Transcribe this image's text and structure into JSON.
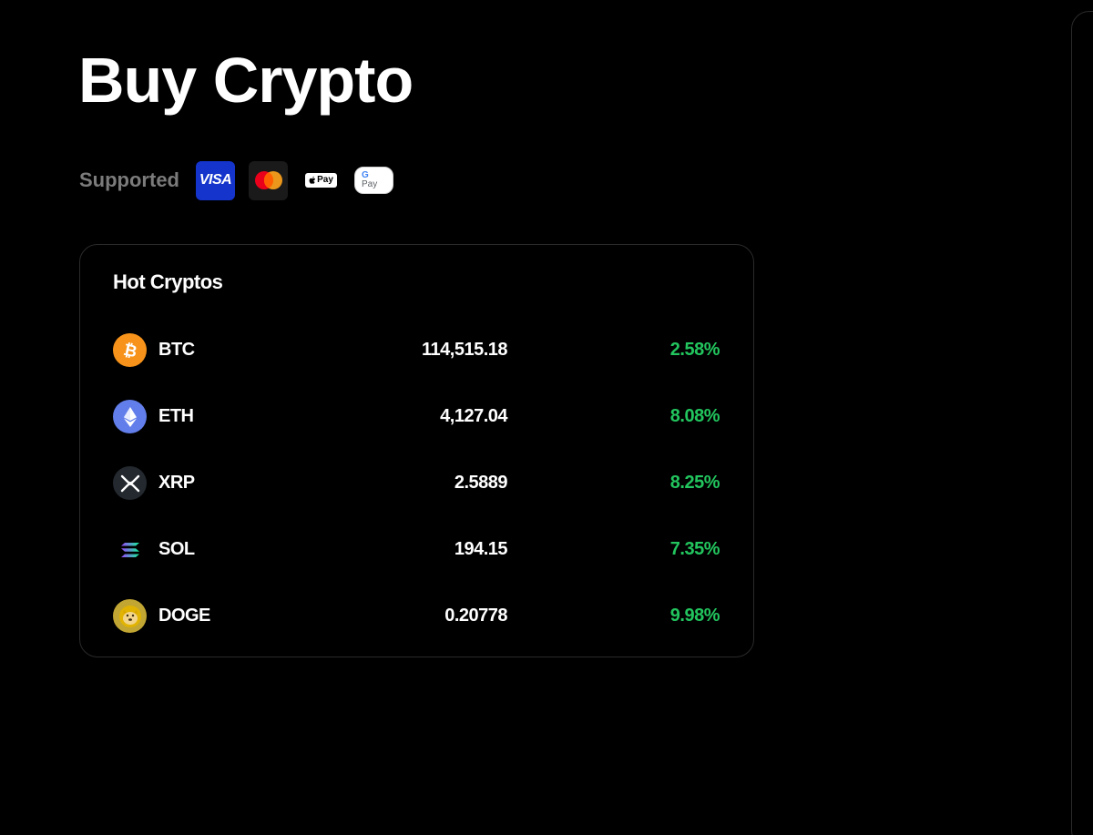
{
  "page": {
    "title": "Buy Crypto"
  },
  "payments": {
    "label": "Supported",
    "methods": [
      {
        "name": "VISA",
        "icon": "visa-icon"
      },
      {
        "name": "Mastercard",
        "icon": "mastercard-icon"
      },
      {
        "name": "Pay",
        "icon": "apple-pay-icon"
      },
      {
        "name": "Pay",
        "icon": "google-pay-icon"
      }
    ]
  },
  "hot_cryptos": {
    "title": "Hot Cryptos",
    "rows": [
      {
        "symbol": "BTC",
        "price": "114,515.18",
        "change": "2.58%",
        "icon": "btc-icon",
        "icon_color": "#f7931a"
      },
      {
        "symbol": "ETH",
        "price": "4,127.04",
        "change": "8.08%",
        "icon": "eth-icon",
        "icon_color": "#627eea"
      },
      {
        "symbol": "XRP",
        "price": "2.5889",
        "change": "8.25%",
        "icon": "xrp-icon",
        "icon_color": "#23292f"
      },
      {
        "symbol": "SOL",
        "price": "194.15",
        "change": "7.35%",
        "icon": "sol-icon",
        "icon_color": "#000000"
      },
      {
        "symbol": "DOGE",
        "price": "0.20778",
        "change": "9.98%",
        "icon": "doge-icon",
        "icon_color": "#c2a633"
      }
    ]
  },
  "colors": {
    "positive": "#22c55e",
    "muted": "#7b7b7b",
    "visa": "#1434cb"
  }
}
